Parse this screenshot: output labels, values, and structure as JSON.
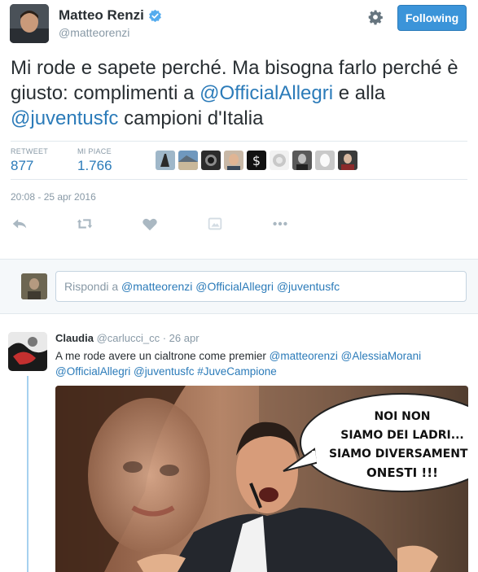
{
  "tweet": {
    "fullname": "Matteo Renzi",
    "handle": "@matteorenzi",
    "follow_label": "Following",
    "text_parts": {
      "p1": "Mi rode e sapete perché. Ma bisogna farlo perché è giusto: complimenti a ",
      "m1": "@OfficialAllegri",
      "p2": " e alla ",
      "m2": "@juventusfc",
      "p3": " campioni d'Italia"
    },
    "stats": {
      "retweet_label": "RETWEET",
      "retweet_count": "877",
      "like_label": "MI PIACE",
      "like_count": "1.766"
    },
    "likers_count": 9,
    "timestamp": "20:08 - 25 apr 2016",
    "actions": [
      "reply-icon",
      "retweet-icon",
      "heart-icon",
      "media-icon",
      "more-icon"
    ]
  },
  "reply_box": {
    "prefix": "Rispondi a ",
    "mentions": "@matteorenzi @OfficialAllegri @juventusfc"
  },
  "reply": {
    "name": "Claudia",
    "handle": "@carlucci_cc",
    "separator": " · ",
    "date": "26 apr",
    "text_plain": "A me rode avere un cialtrone come premier ",
    "text_mentions": "@matteorenzi @AlessiaMorani @OfficialAllegri @juventusfc #JuveCampione",
    "image": {
      "bubble_lines": [
        "NOI NON",
        "SIAMO DEI LADRI...",
        "SIAMO DIVERSAMENTE",
        "ONESTI !!!"
      ]
    }
  },
  "colors": {
    "link": "#2b7bb9",
    "follow_bg": "#3b94d9",
    "muted": "#8899a6",
    "thread_line": "#a6d1ef"
  }
}
